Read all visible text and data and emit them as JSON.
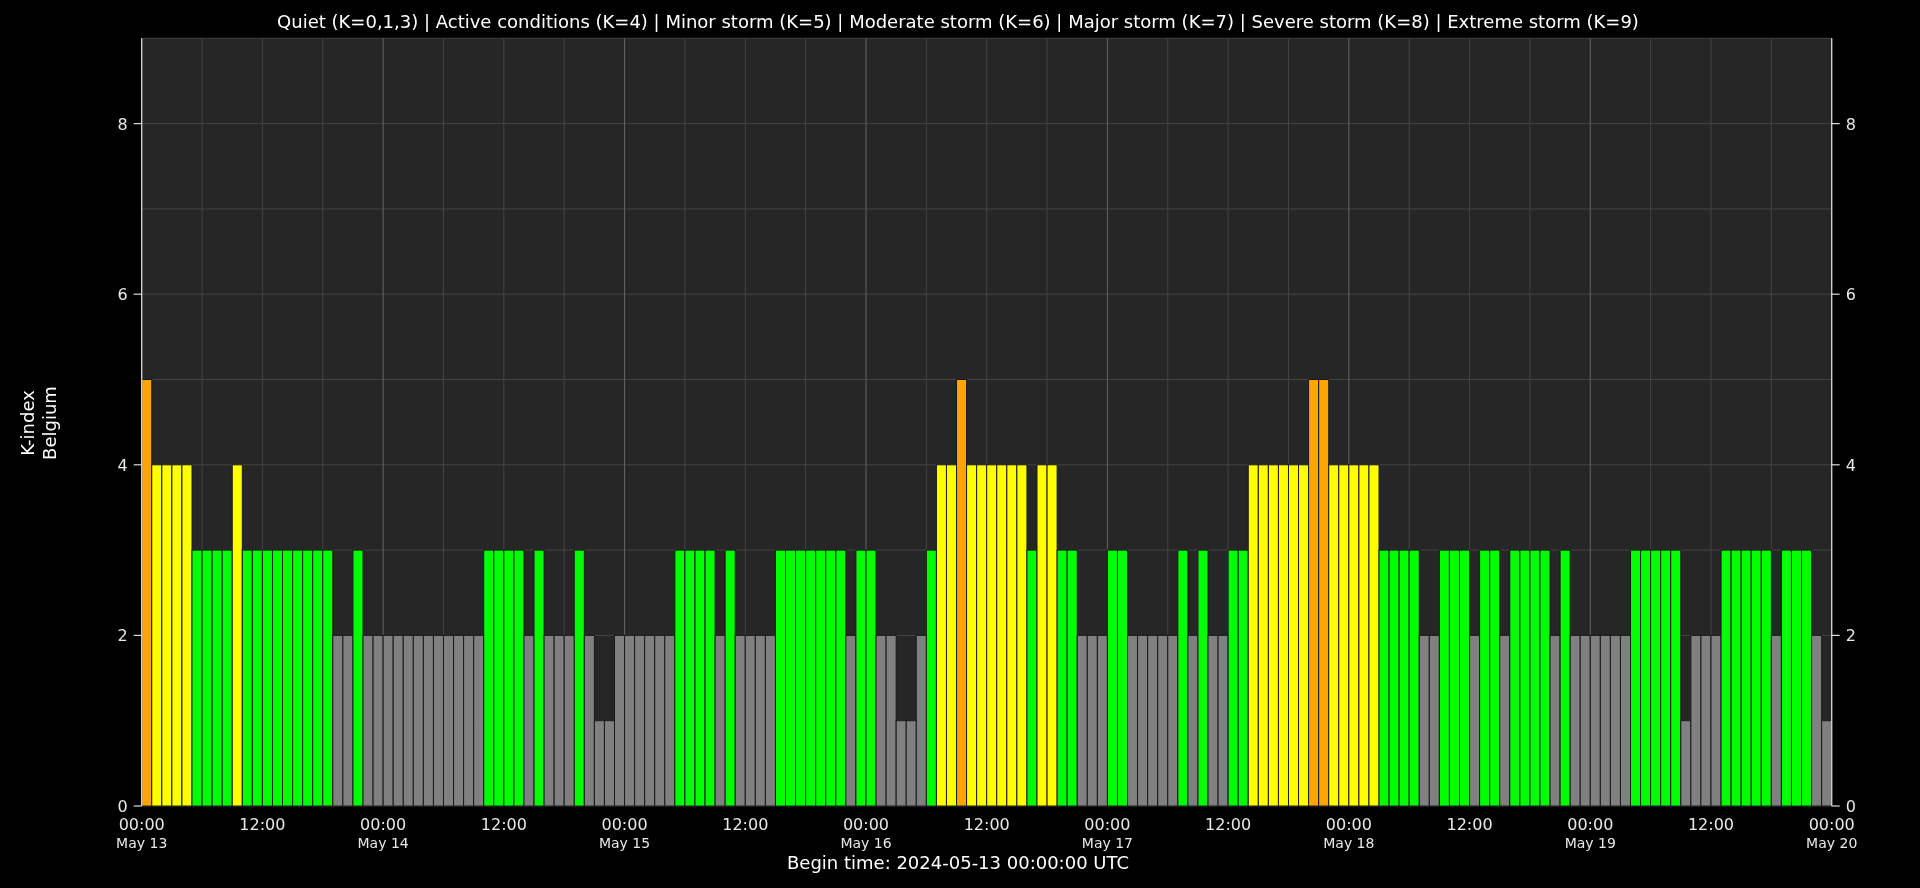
{
  "chart": {
    "chart_data": {
      "type": "bar",
      "title": "Quiet (K=0,1,3) | Active conditions (K=4) | Minor storm (K=5) | Moderate storm (K=6) | Major storm (K=7) | Severe storm (K=8) | Extreme storm (K=9)",
      "xlabel": "Begin time: 2024-05-13 00:00:00 UTC",
      "ylabel": "K-index\nBelgium",
      "ylim": [
        0,
        9
      ],
      "grid": true,
      "yticks": [
        0,
        2,
        4,
        6,
        8
      ],
      "values": [
        5,
        4,
        4,
        4,
        4,
        3,
        3,
        3,
        3,
        4,
        3,
        3,
        3,
        3,
        3,
        3,
        3,
        3,
        3,
        2,
        2,
        3,
        2,
        2,
        2,
        2,
        2,
        2,
        2,
        2,
        2,
        2,
        2,
        2,
        3,
        3,
        3,
        3,
        2,
        3,
        2,
        2,
        2,
        3,
        2,
        1,
        1,
        2,
        2,
        2,
        2,
        2,
        2,
        3,
        3,
        3,
        3,
        2,
        3,
        2,
        2,
        2,
        2,
        3,
        3,
        3,
        3,
        3,
        3,
        3,
        2,
        3,
        3,
        2,
        2,
        1,
        1,
        2,
        3,
        4,
        4,
        5,
        4,
        4,
        4,
        4,
        4,
        4,
        3,
        4,
        4,
        3,
        3,
        2,
        2,
        2,
        3,
        3,
        2,
        2,
        2,
        2,
        2,
        3,
        2,
        3,
        2,
        2,
        3,
        3,
        4,
        4,
        4,
        4,
        4,
        4,
        5,
        5,
        4,
        4,
        4,
        4,
        4,
        3,
        3,
        3,
        3,
        2,
        2,
        3,
        3,
        3,
        2,
        3,
        3,
        2,
        3,
        3,
        3,
        3,
        2,
        3,
        2,
        2,
        2,
        2,
        2,
        2,
        3,
        3,
        3,
        3,
        3,
        1,
        2,
        2,
        2,
        3,
        3,
        3,
        3,
        3,
        2,
        3,
        3,
        3,
        2,
        1
      ]
    },
    "right_axis_ticks": [
      "8",
      "6",
      "4",
      "2",
      "0"
    ],
    "x_axis_labels": [
      {
        "time": "00:00",
        "date": "May 13"
      },
      {
        "time": "12:00"
      },
      {
        "time": "00:00",
        "date": "May 14"
      },
      {
        "time": "12:00"
      },
      {
        "time": "00:00",
        "date": "May 15"
      },
      {
        "time": "12:00"
      },
      {
        "time": "00:00",
        "date": "May 16"
      },
      {
        "time": "12:00"
      },
      {
        "time": "00:00",
        "date": "May 17"
      },
      {
        "time": "12:00"
      },
      {
        "time": "00:00",
        "date": "May 18"
      },
      {
        "time": "12:00"
      },
      {
        "time": "00:00",
        "date": "May 19"
      },
      {
        "time": "12:00"
      },
      {
        "time": "00:00",
        "date": "May 20"
      }
    ]
  }
}
